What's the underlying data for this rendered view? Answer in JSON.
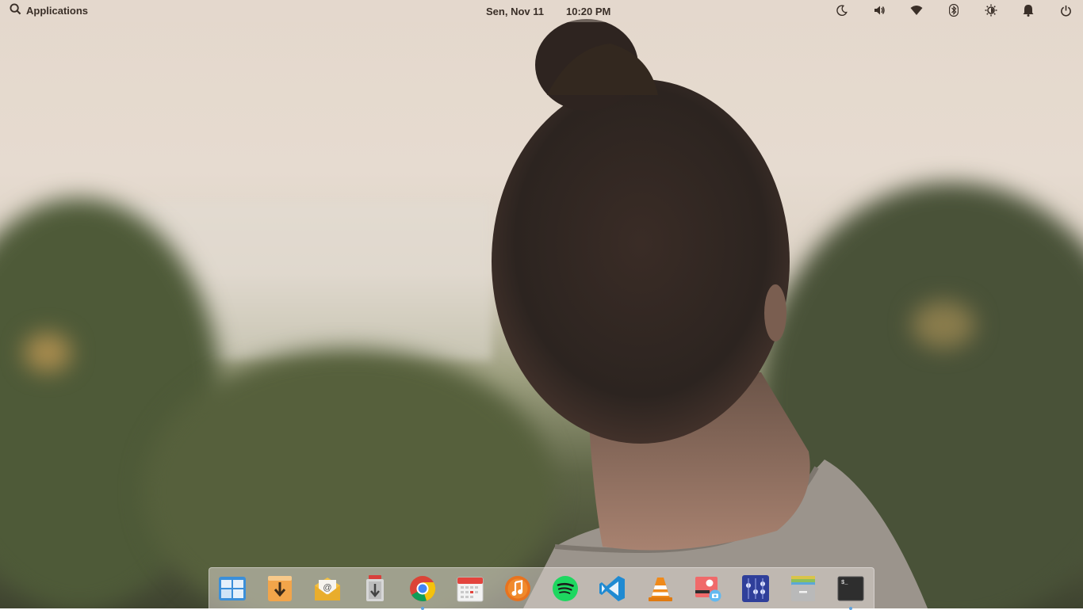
{
  "top_panel": {
    "applications_label": "Applications",
    "date": "Sen, Nov 11",
    "time": "10:20 PM",
    "indicators": [
      "night-light-icon",
      "volume-icon",
      "wifi-icon",
      "bluetooth-icon",
      "brightness-icon",
      "notifications-icon",
      "power-icon"
    ]
  },
  "dock": {
    "items": [
      {
        "name": "multitasking-view-icon",
        "running": false
      },
      {
        "name": "downloads-icon",
        "running": false
      },
      {
        "name": "mail-icon",
        "running": false
      },
      {
        "name": "installer-icon",
        "running": false
      },
      {
        "name": "chrome-icon",
        "running": true
      },
      {
        "name": "calendar-icon",
        "running": false
      },
      {
        "name": "music-icon",
        "running": false
      },
      {
        "name": "spotify-icon",
        "running": false
      },
      {
        "name": "vscode-icon",
        "running": false
      },
      {
        "name": "vlc-icon",
        "running": false
      },
      {
        "name": "screenshot-icon",
        "running": false
      },
      {
        "name": "mixer-icon",
        "running": false
      },
      {
        "name": "files-icon",
        "running": false
      },
      {
        "name": "terminal-icon",
        "running": true
      }
    ]
  },
  "colors": {
    "panel_text": "#3a2f28",
    "dock_running_indicator": "#5fa3e0"
  }
}
